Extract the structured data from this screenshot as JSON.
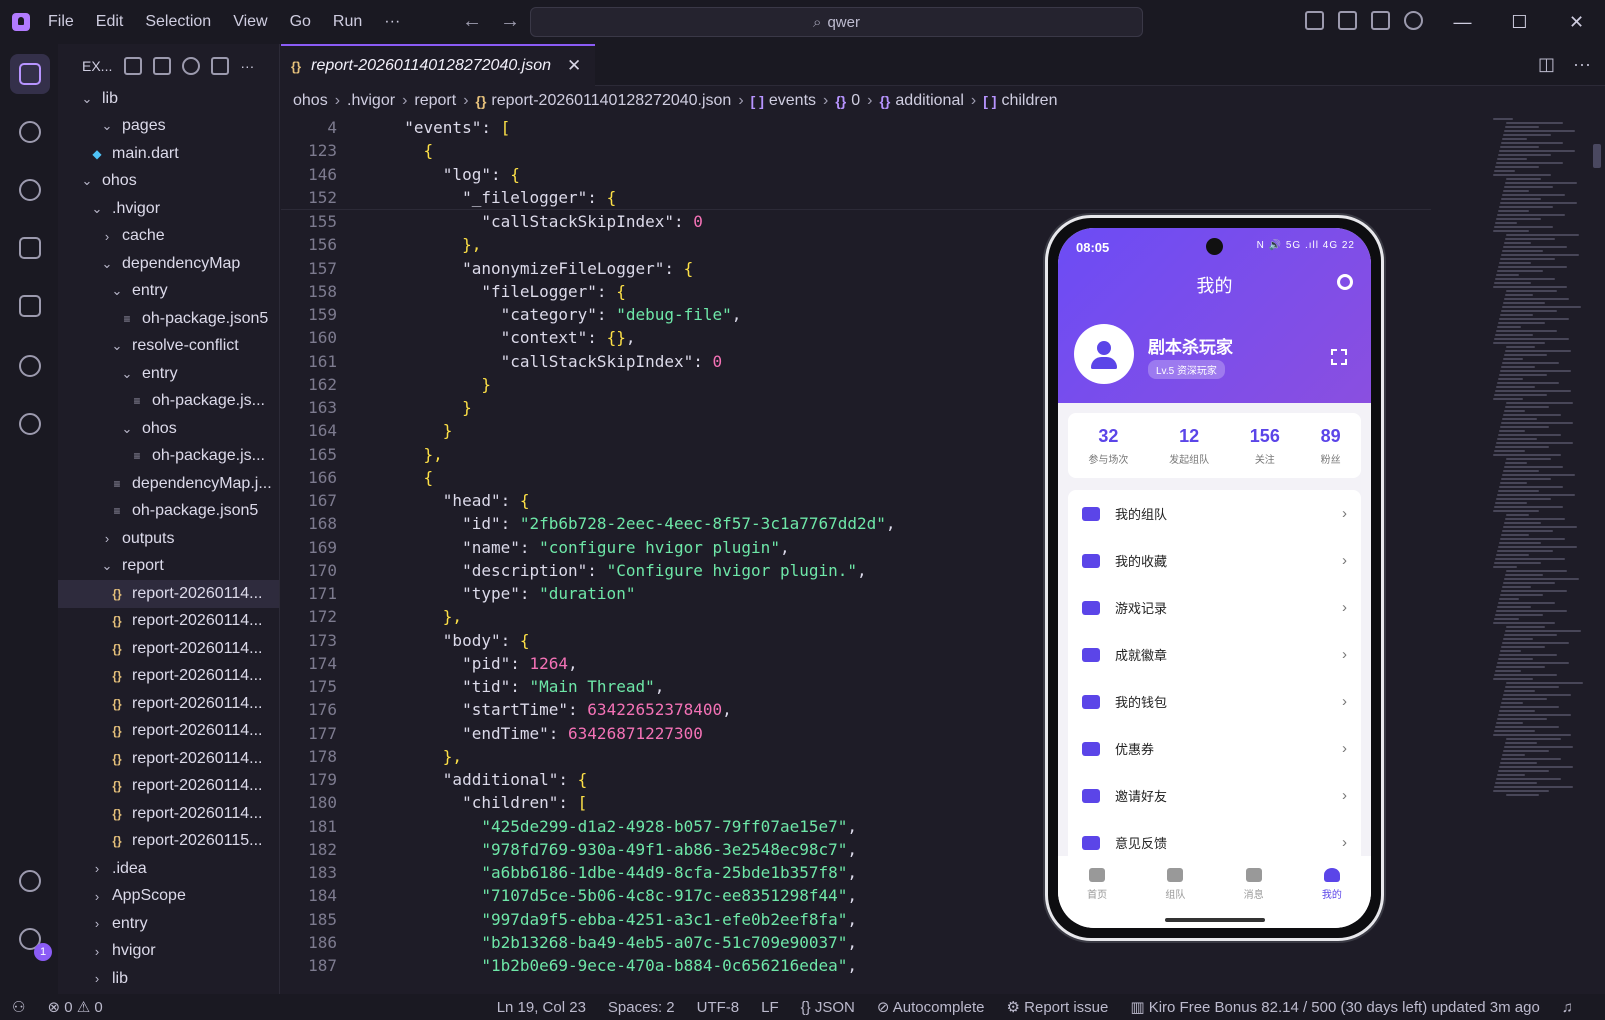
{
  "menu": [
    "File",
    "Edit",
    "Selection",
    "View",
    "Go",
    "Run",
    "···"
  ],
  "search": {
    "value": "qwer"
  },
  "window_controls": [
    "—",
    "☐",
    "✕"
  ],
  "sidebar": {
    "title": "EX...",
    "items": [
      {
        "label": "lib",
        "indent": 1,
        "type": "folder-open"
      },
      {
        "label": "pages",
        "indent": 3,
        "type": "folder-partial"
      },
      {
        "label": "main.dart",
        "indent": 2,
        "type": "dart"
      },
      {
        "label": "ohos",
        "indent": 1,
        "type": "folder-open"
      },
      {
        "label": ".hvigor",
        "indent": 2,
        "type": "folder-open"
      },
      {
        "label": "cache",
        "indent": 3,
        "type": "folder"
      },
      {
        "label": "dependencyMap",
        "indent": 3,
        "type": "folder-open"
      },
      {
        "label": "entry",
        "indent": 4,
        "type": "folder-open"
      },
      {
        "label": "oh-package.json5",
        "indent": 5,
        "type": "file"
      },
      {
        "label": "resolve-conflict",
        "indent": 4,
        "type": "folder-open"
      },
      {
        "label": "entry",
        "indent": 5,
        "type": "folder-open"
      },
      {
        "label": "oh-package.js...",
        "indent": 6,
        "type": "file"
      },
      {
        "label": "ohos",
        "indent": 5,
        "type": "folder-open"
      },
      {
        "label": "oh-package.js...",
        "indent": 6,
        "type": "file"
      },
      {
        "label": "dependencyMap.j...",
        "indent": 4,
        "type": "file"
      },
      {
        "label": "oh-package.json5",
        "indent": 4,
        "type": "file"
      },
      {
        "label": "outputs",
        "indent": 3,
        "type": "folder"
      },
      {
        "label": "report",
        "indent": 3,
        "type": "folder-open"
      },
      {
        "label": "report-20260114...",
        "indent": 4,
        "type": "json",
        "selected": true
      },
      {
        "label": "report-20260114...",
        "indent": 4,
        "type": "json"
      },
      {
        "label": "report-20260114...",
        "indent": 4,
        "type": "json"
      },
      {
        "label": "report-20260114...",
        "indent": 4,
        "type": "json"
      },
      {
        "label": "report-20260114...",
        "indent": 4,
        "type": "json"
      },
      {
        "label": "report-20260114...",
        "indent": 4,
        "type": "json"
      },
      {
        "label": "report-20260114...",
        "indent": 4,
        "type": "json"
      },
      {
        "label": "report-20260114...",
        "indent": 4,
        "type": "json"
      },
      {
        "label": "report-20260114...",
        "indent": 4,
        "type": "json"
      },
      {
        "label": "report-20260115...",
        "indent": 4,
        "type": "json"
      },
      {
        "label": ".idea",
        "indent": 2,
        "type": "folder"
      },
      {
        "label": "AppScope",
        "indent": 2,
        "type": "folder"
      },
      {
        "label": "entry",
        "indent": 2,
        "type": "folder"
      },
      {
        "label": "hvigor",
        "indent": 2,
        "type": "folder"
      },
      {
        "label": "lib",
        "indent": 2,
        "type": "folder"
      }
    ]
  },
  "tab": {
    "label": "report-202601140128272040.json",
    "icon": "{}",
    "close": "✕"
  },
  "breadcrumb": [
    "ohos",
    ".hvigor",
    "report",
    "report-202601140128272040.json",
    "events",
    "0",
    "additional",
    "children"
  ],
  "code_lines": [
    {
      "n": "4",
      "parts": [
        [
          "k",
          "  \"events\": "
        ],
        [
          "b",
          "["
        ]
      ]
    },
    {
      "n": "123",
      "parts": [
        [
          "b",
          "    {"
        ]
      ]
    },
    {
      "n": "146",
      "parts": [
        [
          "k",
          "      \"log\": "
        ],
        [
          "b",
          "{"
        ]
      ]
    },
    {
      "n": "152",
      "parts": [
        [
          "k",
          "        \"_filelogger\": "
        ],
        [
          "b",
          "{"
        ]
      ]
    },
    {
      "n": "155",
      "parts": [
        [
          "k",
          "          \"callStackSkipIndex\": "
        ],
        [
          "n",
          "0"
        ]
      ]
    },
    {
      "n": "156",
      "parts": [
        [
          "b",
          "        },"
        ]
      ]
    },
    {
      "n": "157",
      "parts": [
        [
          "k",
          "        \"anonymizeFileLogger\": "
        ],
        [
          "b",
          "{"
        ]
      ]
    },
    {
      "n": "158",
      "parts": [
        [
          "k",
          "          \"fileLogger\": "
        ],
        [
          "b",
          "{"
        ]
      ]
    },
    {
      "n": "159",
      "parts": [
        [
          "k",
          "            \"category\": "
        ],
        [
          "s",
          "\"debug-file\""
        ],
        [
          "k",
          ","
        ]
      ]
    },
    {
      "n": "160",
      "parts": [
        [
          "k",
          "            \"context\": "
        ],
        [
          "b",
          "{}"
        ],
        [
          "k",
          ","
        ]
      ]
    },
    {
      "n": "161",
      "parts": [
        [
          "k",
          "            \"callStackSkipIndex\": "
        ],
        [
          "n",
          "0"
        ]
      ]
    },
    {
      "n": "162",
      "parts": [
        [
          "b",
          "          }"
        ]
      ]
    },
    {
      "n": "163",
      "parts": [
        [
          "b",
          "        }"
        ]
      ]
    },
    {
      "n": "164",
      "parts": [
        [
          "b",
          "      }"
        ]
      ]
    },
    {
      "n": "165",
      "parts": [
        [
          "b",
          "    },"
        ]
      ]
    },
    {
      "n": "166",
      "parts": [
        [
          "b",
          "    {"
        ]
      ]
    },
    {
      "n": "167",
      "parts": [
        [
          "k",
          "      \"head\": "
        ],
        [
          "b",
          "{"
        ]
      ]
    },
    {
      "n": "168",
      "parts": [
        [
          "k",
          "        \"id\": "
        ],
        [
          "s",
          "\"2fb6b728-2eec-4eec-8f57-3c1a7767dd2d\""
        ],
        [
          "k",
          ","
        ]
      ]
    },
    {
      "n": "169",
      "parts": [
        [
          "k",
          "        \"name\": "
        ],
        [
          "s",
          "\"configure hvigor plugin\""
        ],
        [
          "k",
          ","
        ]
      ]
    },
    {
      "n": "170",
      "parts": [
        [
          "k",
          "        \"description\": "
        ],
        [
          "s",
          "\"Configure hvigor plugin.\""
        ],
        [
          "k",
          ","
        ]
      ]
    },
    {
      "n": "171",
      "parts": [
        [
          "k",
          "        \"type\": "
        ],
        [
          "s",
          "\"duration\""
        ]
      ]
    },
    {
      "n": "172",
      "parts": [
        [
          "b",
          "      },"
        ]
      ]
    },
    {
      "n": "173",
      "parts": [
        [
          "k",
          "      \"body\": "
        ],
        [
          "b",
          "{"
        ]
      ]
    },
    {
      "n": "174",
      "parts": [
        [
          "k",
          "        \"pid\": "
        ],
        [
          "n",
          "1264"
        ],
        [
          "k",
          ","
        ]
      ]
    },
    {
      "n": "175",
      "parts": [
        [
          "k",
          "        \"tid\": "
        ],
        [
          "s",
          "\"Main Thread\""
        ],
        [
          "k",
          ","
        ]
      ]
    },
    {
      "n": "176",
      "parts": [
        [
          "k",
          "        \"startTime\": "
        ],
        [
          "n",
          "63422652378400"
        ],
        [
          "k",
          ","
        ]
      ]
    },
    {
      "n": "177",
      "parts": [
        [
          "k",
          "        \"endTime\": "
        ],
        [
          "n",
          "63426871227300"
        ]
      ]
    },
    {
      "n": "178",
      "parts": [
        [
          "b",
          "      },"
        ]
      ]
    },
    {
      "n": "179",
      "parts": [
        [
          "k",
          "      \"additional\": "
        ],
        [
          "b",
          "{"
        ]
      ]
    },
    {
      "n": "180",
      "parts": [
        [
          "k",
          "        \"children\": "
        ],
        [
          "b",
          "["
        ]
      ]
    },
    {
      "n": "181",
      "parts": [
        [
          "s",
          "          \"425de299-d1a2-4928-b057-79ff07ae15e7\""
        ],
        [
          "k",
          ","
        ]
      ]
    },
    {
      "n": "182",
      "parts": [
        [
          "s",
          "          \"978fd769-930a-49f1-ab86-3e2548ec98c7\""
        ],
        [
          "k",
          ","
        ]
      ]
    },
    {
      "n": "183",
      "parts": [
        [
          "s",
          "          \"a6bb6186-1dbe-44d9-8cfa-25bde1b357f8\""
        ],
        [
          "k",
          ","
        ]
      ]
    },
    {
      "n": "184",
      "parts": [
        [
          "s",
          "          \"7107d5ce-5b06-4c8c-917c-ee8351298f44\""
        ],
        [
          "k",
          ","
        ]
      ]
    },
    {
      "n": "185",
      "parts": [
        [
          "s",
          "          \"997da9f5-ebba-4251-a3c1-efe0b2eef8fa\""
        ],
        [
          "k",
          ","
        ]
      ]
    },
    {
      "n": "186",
      "parts": [
        [
          "s",
          "          \"b2b13268-ba49-4eb5-a07c-51c709e90037\""
        ],
        [
          "k",
          ","
        ]
      ]
    },
    {
      "n": "187",
      "parts": [
        [
          "s",
          "          \"1b2b0e69-9ece-470a-b884-0c656216edea\""
        ],
        [
          "k",
          ","
        ]
      ]
    }
  ],
  "phone": {
    "time": "08:05",
    "sys_icons": "N 🔊 5G .ıll 4G 22",
    "title": "我的",
    "user_name": "剧本杀玩家",
    "user_level": "Lv.5 资深玩家",
    "stats": [
      {
        "num": "32",
        "label": "参与场次"
      },
      {
        "num": "12",
        "label": "发起组队"
      },
      {
        "num": "156",
        "label": "关注"
      },
      {
        "num": "89",
        "label": "粉丝"
      }
    ],
    "menu": [
      "我的组队",
      "我的收藏",
      "游戏记录",
      "成就徽章",
      "我的钱包",
      "优惠券",
      "邀请好友",
      "意见反馈"
    ],
    "tabs": [
      "首页",
      "组队",
      "消息",
      "我的"
    ]
  },
  "statusbar": {
    "errors": "0",
    "warnings": "0",
    "position": "Ln 19, Col 23",
    "spaces": "Spaces: 2",
    "encoding": "UTF-8",
    "eol": "LF",
    "language": "{} JSON",
    "autocomplete": "Autocomplete",
    "report": "Report issue",
    "bonus": "Kiro Free Bonus 82.14 / 500 (30 days left) updated 3m ago"
  },
  "account_badge": "1"
}
